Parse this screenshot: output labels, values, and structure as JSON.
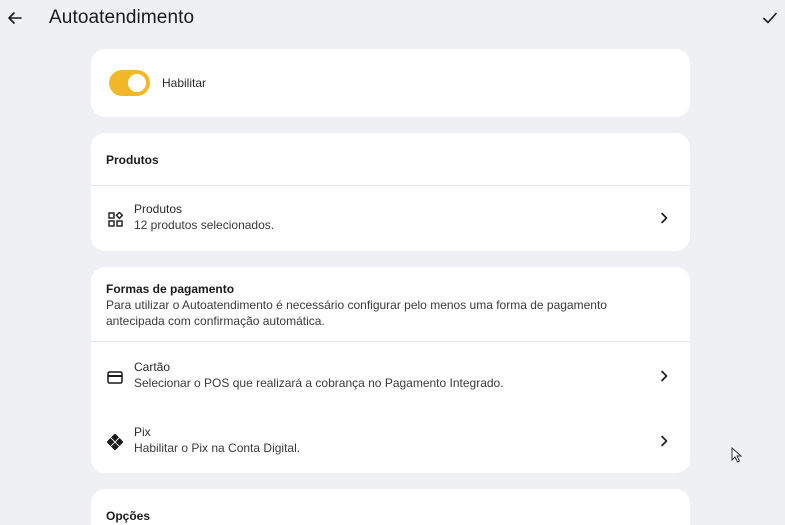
{
  "header": {
    "title": "Autoatendimento",
    "back_icon": "arrow-left-icon",
    "confirm_icon": "check-icon"
  },
  "enable": {
    "label": "Habilitar",
    "enabled": true,
    "accent_color": "#f1b927"
  },
  "produtos": {
    "section_title": "Produtos",
    "row": {
      "icon": "category-grid-icon",
      "title": "Produtos",
      "subtitle": "12 produtos selecionados."
    }
  },
  "pagamento": {
    "section_title": "Formas de pagamento",
    "description": "Para utilizar o Autoatendimento é necessário configurar pelo menos uma forma de pagamento antecipada com confirmação automática.",
    "rows": [
      {
        "icon": "credit-card-icon",
        "title": "Cartão",
        "subtitle": "Selecionar o POS que realizará a cobrança no Pagamento Integrado."
      },
      {
        "icon": "pix-icon",
        "title": "Pix",
        "subtitle": "Habilitar o Pix na Conta Digital."
      }
    ]
  },
  "opcoes": {
    "section_title": "Opções"
  }
}
